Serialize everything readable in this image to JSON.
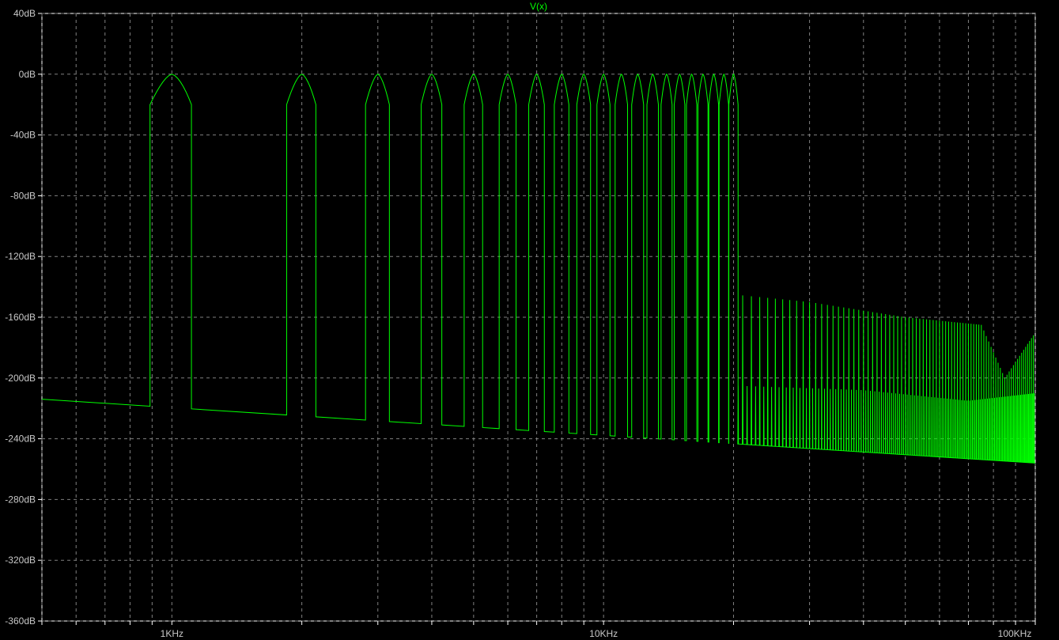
{
  "chart_data": {
    "type": "line",
    "title": "",
    "xscale": "log",
    "xlabel": "",
    "ylabel": "",
    "xlim": [
      500,
      100000
    ],
    "ylim": [
      -360,
      40
    ],
    "grid": true,
    "y_ticks": [
      40,
      0,
      -40,
      -80,
      -120,
      -160,
      -200,
      -240,
      -280,
      -320,
      -360
    ],
    "y_tick_labels": [
      "40dB",
      "0dB",
      "-40dB",
      "-80dB",
      "-120dB",
      "-160dB",
      "-200dB",
      "-240dB",
      "-280dB",
      "-320dB",
      "-360dB"
    ],
    "x_ticks": [
      1000,
      10000,
      100000
    ],
    "x_tick_labels": [
      "1KHz",
      "10KHz",
      "100KHz"
    ],
    "series": [
      {
        "name": "V(x)",
        "color": "#00ff00",
        "noise_floor_db": [
          [
            500,
            -214
          ],
          [
            100000,
            -256
          ]
        ],
        "main_peaks_hz": [
          1000,
          2000,
          3000,
          4000,
          5000,
          6000,
          7000,
          8000,
          9000,
          10000,
          11000,
          12000,
          13000,
          14000,
          15000,
          16000,
          17000,
          18000,
          19000,
          20000
        ],
        "main_peak_db": 0,
        "main_peak_shoulder_db": -20,
        "residual_spurs_hz_range": [
          20000,
          100000
        ],
        "residual_spur_envelope_db": [
          [
            20000,
            -145
          ],
          [
            30000,
            -150
          ],
          [
            50000,
            -160
          ],
          [
            75000,
            -165
          ],
          [
            85000,
            -200
          ],
          [
            100000,
            -170
          ]
        ],
        "residual_spur_secondary_envelope_db": [
          [
            20000,
            -205
          ],
          [
            40000,
            -208
          ],
          [
            70000,
            -215
          ],
          [
            100000,
            -210
          ]
        ]
      }
    ]
  }
}
